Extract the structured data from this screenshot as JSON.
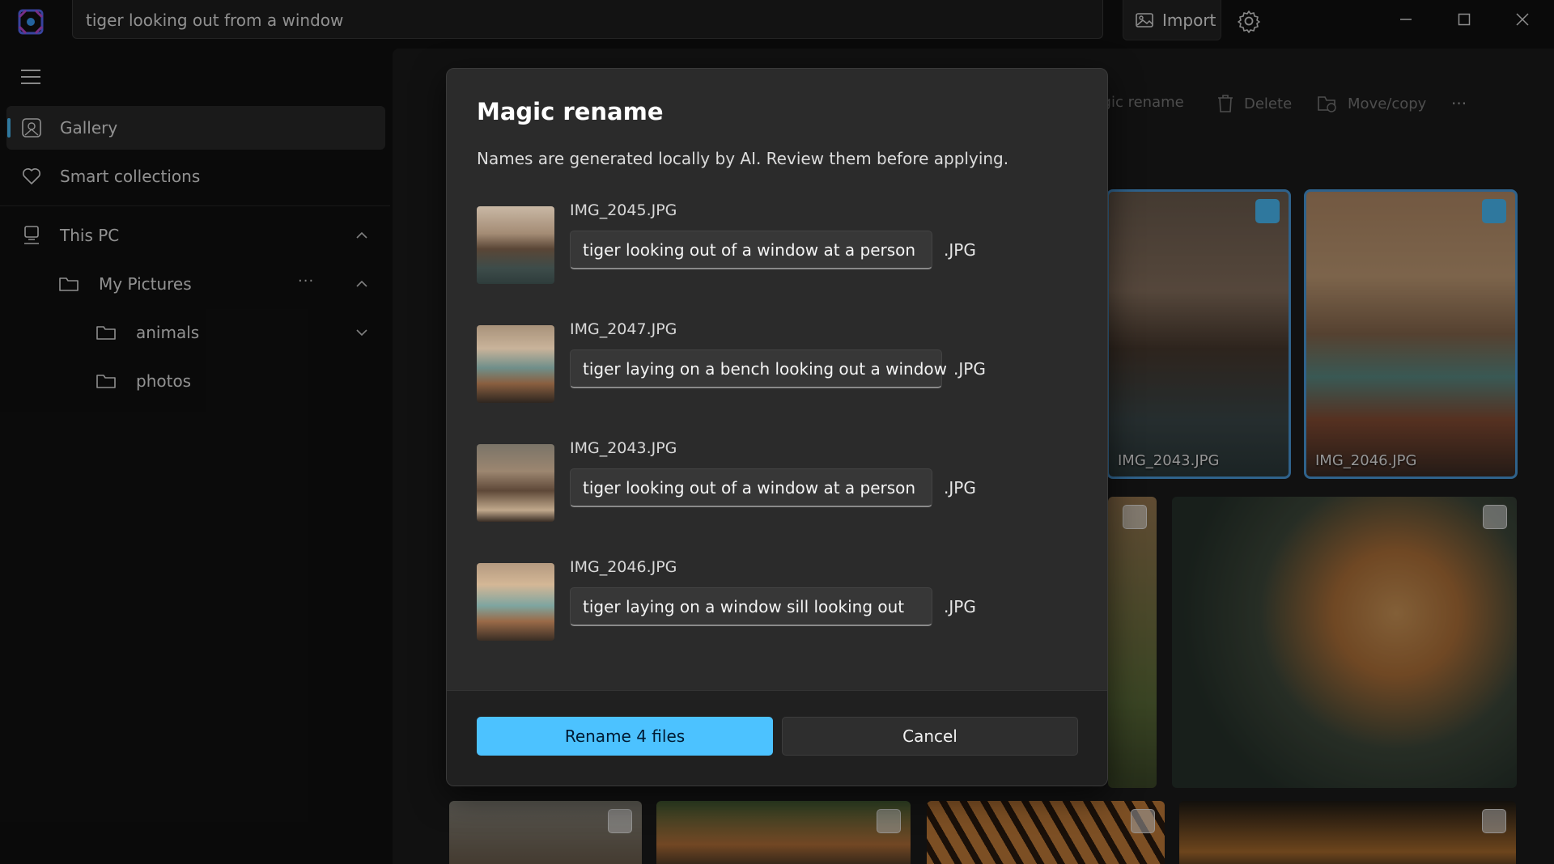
{
  "search": {
    "value": "tiger looking out from a window"
  },
  "titlebar": {
    "import_label": "Import"
  },
  "sidebar": {
    "items": [
      {
        "label": "Gallery"
      },
      {
        "label": "Smart collections"
      },
      {
        "label": "This PC"
      },
      {
        "label": "My Pictures",
        "more": "···"
      },
      {
        "label": "animals"
      },
      {
        "label": "photos"
      }
    ]
  },
  "toolbar": {
    "magic_rename": "Magic rename",
    "delete": "Delete",
    "move_copy": "Move/copy",
    "more": "···"
  },
  "gallery": {
    "tiles": [
      {
        "filename": "IMG_2043.JPG",
        "selected": true
      },
      {
        "filename": "IMG_2046.JPG",
        "selected": true
      }
    ]
  },
  "dialog": {
    "title": "Magic rename",
    "description": "Names are generated locally by AI. Review them before applying.",
    "rows": [
      {
        "original": "IMG_2045.JPG",
        "new_name": "tiger looking out of a window at a person",
        "ext": ".JPG"
      },
      {
        "original": "IMG_2047.JPG",
        "new_name": "tiger laying on a bench looking out a window",
        "ext": ".JPG"
      },
      {
        "original": "IMG_2043.JPG",
        "new_name": "tiger looking out of a window at a person",
        "ext": ".JPG"
      },
      {
        "original": "IMG_2046.JPG",
        "new_name": "tiger laying on a window sill looking out",
        "ext": ".JPG"
      }
    ],
    "rename_button": "Rename 4 files",
    "cancel_button": "Cancel"
  },
  "colors": {
    "accent": "#4cc2ff",
    "background": "#111111",
    "dialog": "#2b2b2b"
  }
}
